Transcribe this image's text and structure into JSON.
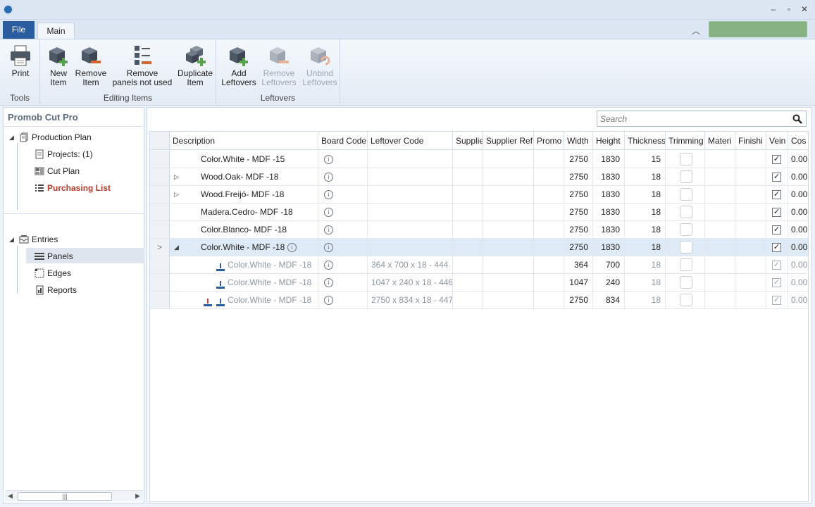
{
  "window": {
    "minimize": "‒",
    "restore": "▫",
    "close": "✕"
  },
  "ribbon": {
    "tabs": {
      "file": "File",
      "main": "Main"
    },
    "groups": {
      "tools": {
        "label": "Tools",
        "print": "Print"
      },
      "editing": {
        "label": "Editing Items",
        "new_item": "New\nItem",
        "remove_item": "Remove\nItem",
        "remove_unused": "Remove\npanels not used",
        "duplicate_item": "Duplicate\nItem"
      },
      "leftovers": {
        "label": "Leftovers",
        "add": "Add\nLeftovers",
        "remove": "Remove\nLeftovers",
        "unbind": "Unbind\nLeftovers"
      }
    },
    "status_color": "#86b283"
  },
  "sidebar": {
    "title": "Promob Cut Pro",
    "tree": {
      "production_plan": "Production Plan",
      "projects": "Projects: (1)",
      "cut_plan": "Cut Plan",
      "purchasing_list": "Purchasing List",
      "entries": "Entries",
      "panels": "Panels",
      "edges": "Edges",
      "reports": "Reports"
    },
    "accent_color": "#b33a2a"
  },
  "search": {
    "placeholder": "Search"
  },
  "grid": {
    "columns": [
      "Description",
      "Board Code",
      "Leftover Code",
      "Supplie",
      "Supplier Ref",
      "Promo",
      "Width",
      "Height",
      "Thickness",
      "Trimming",
      "Materi",
      "Finishi",
      "Vein",
      "Cos"
    ],
    "rows": [
      {
        "description": "Color.White - MDF -15",
        "leftover": "",
        "width": "2750",
        "height": "1830",
        "thickness": "15",
        "vein": "✓",
        "cost": "0.00"
      },
      {
        "description": "Wood.Oak- MDF -18",
        "leftover": "",
        "width": "2750",
        "height": "1830",
        "thickness": "18",
        "vein": "✓",
        "cost": "0.00"
      },
      {
        "description": "Wood.Freijó- MDF -18",
        "leftover": "",
        "width": "2750",
        "height": "1830",
        "thickness": "18",
        "vein": "✓",
        "cost": "0.00"
      },
      {
        "description": "Madera.Cedro- MDF -18",
        "leftover": "",
        "width": "2750",
        "height": "1830",
        "thickness": "18",
        "vein": "✓",
        "cost": "0.00"
      },
      {
        "description": "Color.Blanco- MDF -18",
        "leftover": "",
        "width": "2750",
        "height": "1830",
        "thickness": "18",
        "vein": "✓",
        "cost": "0.00"
      },
      {
        "description": "Color.White - MDF -18",
        "leftover": "",
        "width": "2750",
        "height": "1830",
        "thickness": "18",
        "vein": "✓",
        "cost": "0.00"
      },
      {
        "description": "Color.White - MDF -18",
        "leftover": "364 x 700 x 18 - 444",
        "width": "364",
        "height": "700",
        "thickness": "18",
        "vein": "✓",
        "cost": "0.00"
      },
      {
        "description": "Color.White - MDF -18",
        "leftover": "1047 x 240 x 18 - 446",
        "width": "1047",
        "height": "240",
        "thickness": "18",
        "vein": "✓",
        "cost": "0.00"
      },
      {
        "description": "Color.White - MDF -18",
        "leftover": "2750 x 834 x 18 - 447",
        "width": "2750",
        "height": "834",
        "thickness": "18",
        "vein": "✓",
        "cost": "0.00"
      }
    ]
  }
}
